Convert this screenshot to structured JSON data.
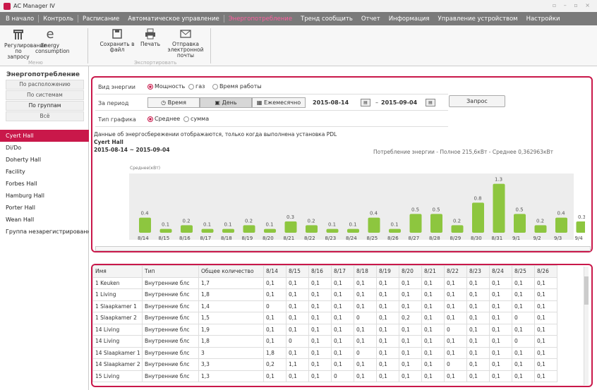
{
  "window": {
    "title": "AC Manager IV"
  },
  "menu": [
    "В начало",
    "Контроль",
    "Расписание",
    "Автоматическое управление",
    "Энергопотребление",
    "Тренд сообщить",
    "Отчет",
    "Информация",
    "Управление устройством",
    "Настройки"
  ],
  "menu_active": 4,
  "ribbon": {
    "btn1": "Регулирование по запросу",
    "btn2": "Energy consumption",
    "group1": "Меню",
    "save": "Сохранить в файл",
    "print": "Печать",
    "email": "Отправка электронной почты",
    "group2": "Экспортировать"
  },
  "sidebar": {
    "title": "Энергопотребление",
    "tabs": [
      "По расположению",
      "По системам",
      "По группам",
      "Всё"
    ],
    "items": [
      "Cyert Hall",
      "Di/Do",
      "Doherty Hall",
      "Facility",
      "Forbes Hall",
      "Hamburg Hall",
      "Porter Hall",
      "Wean Hall",
      "Группа незарегистрированн"
    ]
  },
  "form": {
    "energy_label": "Вид энергии",
    "energy_opts": [
      "Мощность",
      "газ",
      "Время работы"
    ],
    "period_label": "За период",
    "period_opts": [
      "Время",
      "День",
      "Ежемесячно"
    ],
    "date_from": "2015-08-14",
    "date_sep": "–",
    "date_to": "2015-09-04",
    "chart_type_label": "Тип графика",
    "chart_type_opts": [
      "Среднее",
      "сумма"
    ],
    "query": "Запрос"
  },
  "info": {
    "note": "Данные об энергосбережении отображаются, только когда выполнена установка PDL",
    "name": "Cyert Hall",
    "range": "2015-08-14 ~ 2015-09-04",
    "summary": "Потребление энергии  - Полное  215,6кВт  - Среднее  0,362963кВт"
  },
  "chart_data": {
    "type": "bar",
    "ylabel": "Среднее(кВт)",
    "categories": [
      "8/14",
      "8/15",
      "8/16",
      "8/17",
      "8/18",
      "8/19",
      "8/20",
      "8/21",
      "8/22",
      "8/23",
      "8/24",
      "8/25",
      "8/26",
      "8/27",
      "8/28",
      "8/29",
      "8/30",
      "8/31",
      "9/1",
      "9/2",
      "9/3",
      "9/4"
    ],
    "values": [
      0.4,
      0.1,
      0.2,
      0.1,
      0.1,
      0.2,
      0.1,
      0.3,
      0.2,
      0.1,
      0.1,
      0.4,
      0.1,
      0.5,
      0.5,
      0.2,
      0.8,
      1.3,
      0.5,
      0.2,
      0.4,
      0.3
    ],
    "labels": [
      "0.4",
      "0.1",
      "0.2",
      "0.1",
      "0.1",
      "0.2",
      "0.1",
      "0.3",
      "0.2",
      "0.1",
      "0.1",
      "0.4",
      "0.1",
      "0.5",
      "0.5",
      "0.2",
      "0.8",
      "1.3",
      "0.5",
      "0.2",
      "0.4",
      "0.3"
    ],
    "ylim": [
      0,
      1.5
    ],
    "colors": {
      "bar": "#8dc63f"
    }
  },
  "table": {
    "headers": [
      "Имя",
      "Тип",
      "Общее количество",
      "8/14",
      "8/15",
      "8/16",
      "8/17",
      "8/18",
      "8/19",
      "8/20",
      "8/21",
      "8/22",
      "8/23",
      "8/24",
      "8/25",
      "8/26"
    ],
    "rows": [
      [
        "1 Keuken",
        "Внутренние блс",
        "1,7",
        "0,1",
        "0,1",
        "0,1",
        "0,1",
        "0,1",
        "0,1",
        "0,1",
        "0,1",
        "0,1",
        "0,1",
        "0,1",
        "0,1",
        "0,1"
      ],
      [
        "1 Living",
        "Внутренние блс",
        "1,8",
        "0,1",
        "0,1",
        "0,1",
        "0,1",
        "0,1",
        "0,1",
        "0,1",
        "0,1",
        "0,1",
        "0,1",
        "0,1",
        "0,1",
        "0,1"
      ],
      [
        "1 Slaapkamer 1",
        "Внутренние блс",
        "1,4",
        "0",
        "0,1",
        "0,1",
        "0,1",
        "0,1",
        "0,1",
        "0,1",
        "0,1",
        "0,1",
        "0,1",
        "0,1",
        "0,1",
        "0,1"
      ],
      [
        "1 Slaapkamer 2",
        "Внутренние блс",
        "1,5",
        "0,1",
        "0,1",
        "0,1",
        "0,1",
        "0",
        "0,1",
        "0,2",
        "0,1",
        "0,1",
        "0,1",
        "0,1",
        "0",
        "0,1"
      ],
      [
        "14 Living",
        "Внутренние блс",
        "1,9",
        "0,1",
        "0,1",
        "0,1",
        "0,1",
        "0,1",
        "0,1",
        "0,1",
        "0,1",
        "0",
        "0,1",
        "0,1",
        "0,1",
        "0,1"
      ],
      [
        "14 Living",
        "Внутренние блс",
        "1,8",
        "0,1",
        "0",
        "0,1",
        "0,1",
        "0,1",
        "0,1",
        "0,1",
        "0,1",
        "0,1",
        "0,1",
        "0,1",
        "0",
        "0,1"
      ],
      [
        "14 Slaapkamer 1",
        "Внутренние блс",
        "3",
        "1,8",
        "0,1",
        "0,1",
        "0,1",
        "0",
        "0,1",
        "0,1",
        "0,1",
        "0,1",
        "0,1",
        "0,1",
        "0,1",
        "0,1"
      ],
      [
        "14 Slaapkamer 2",
        "Внутренние блс",
        "3,3",
        "0,2",
        "1,1",
        "0,1",
        "0,1",
        "0,1",
        "0,1",
        "0,1",
        "0,1",
        "0",
        "0,1",
        "0,1",
        "0,1",
        "0,1"
      ],
      [
        "15 Living",
        "Внутренние блс",
        "1,3",
        "0,1",
        "0,1",
        "0,1",
        "0",
        "0,1",
        "0,1",
        "0,1",
        "0,1",
        "0,1",
        "0,1",
        "0,1",
        "0,1",
        "0,1"
      ]
    ]
  }
}
